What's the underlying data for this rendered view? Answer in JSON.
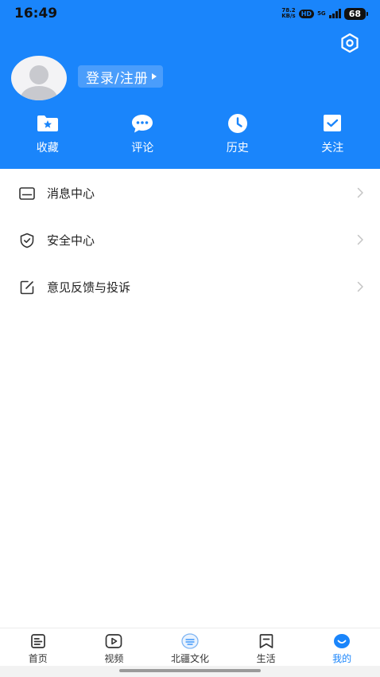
{
  "status_bar": {
    "time": "16:49",
    "net_speed_value": "78.2",
    "net_speed_unit": "KB/s",
    "hd": "HD",
    "network": "5G",
    "battery": "68"
  },
  "profile": {
    "login_label": "登录/注册"
  },
  "shortcuts": [
    {
      "label": "收藏",
      "icon": "folder-star-icon"
    },
    {
      "label": "评论",
      "icon": "comment-bubble-icon"
    },
    {
      "label": "历史",
      "icon": "clock-icon"
    },
    {
      "label": "关注",
      "icon": "follow-check-icon"
    }
  ],
  "menu": [
    {
      "label": "消息中心",
      "icon": "envelope-icon"
    },
    {
      "label": "安全中心",
      "icon": "shield-check-icon"
    },
    {
      "label": "意见反馈与投诉",
      "icon": "edit-square-icon"
    }
  ],
  "tabs": [
    {
      "label": "首页",
      "icon": "news-icon",
      "active": false
    },
    {
      "label": "视频",
      "icon": "video-play-icon",
      "active": false
    },
    {
      "label": "北疆文化",
      "icon": "culture-logo-icon",
      "active": false
    },
    {
      "label": "生活",
      "icon": "life-bookmark-icon",
      "active": false
    },
    {
      "label": "我的",
      "icon": "profile-smile-icon",
      "active": true
    }
  ],
  "colors": {
    "brand_blue": "#1a85fb",
    "header_button": "#4a9dfb"
  }
}
